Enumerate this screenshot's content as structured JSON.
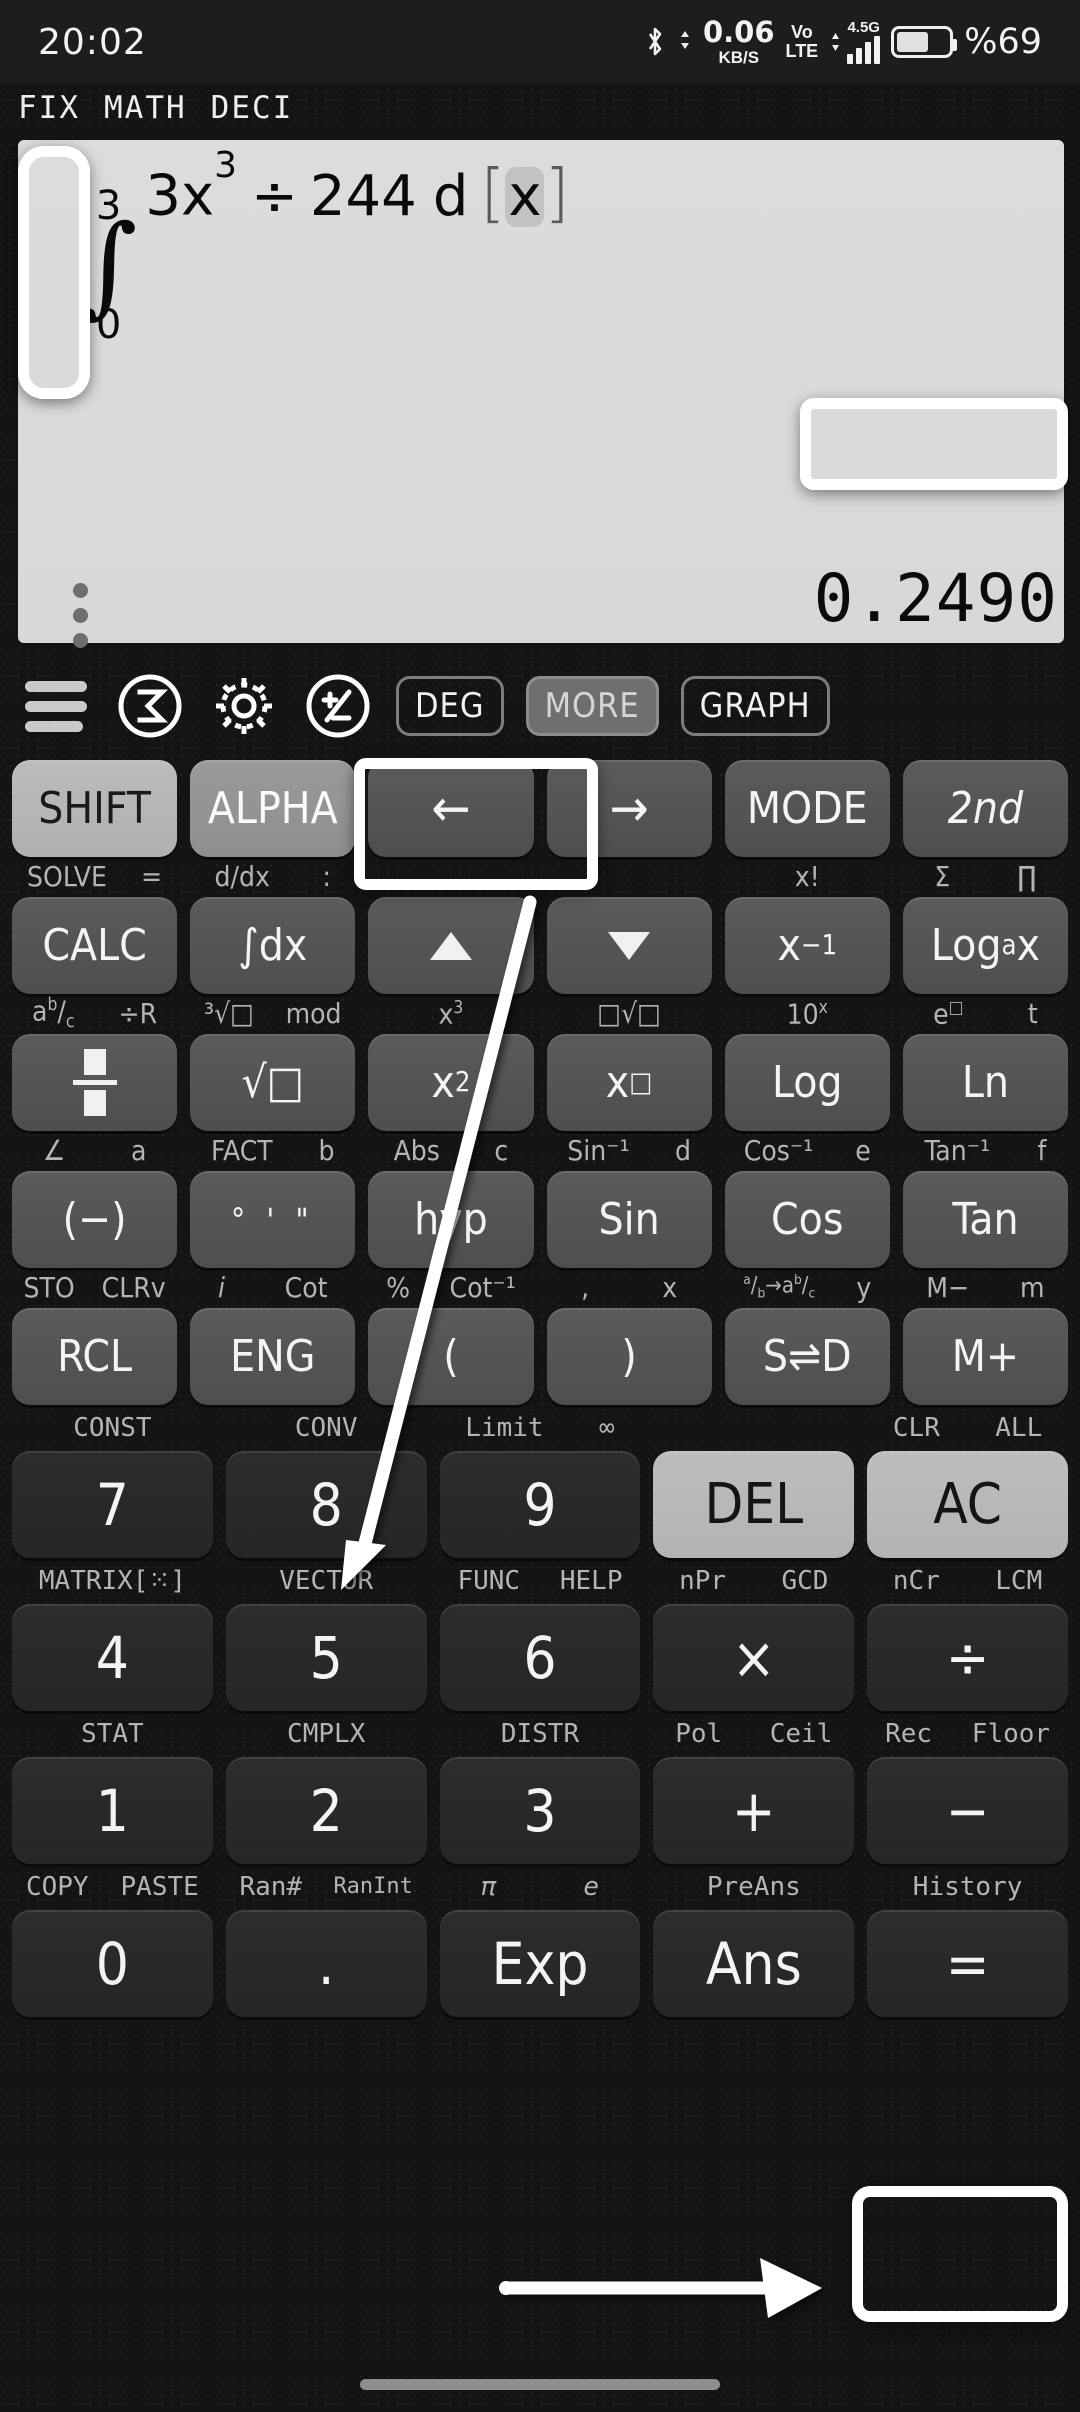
{
  "statusbar": {
    "time": "20:02",
    "net_speed_value": "0.06",
    "net_speed_unit": "KB/S",
    "volte_line1": "Vo",
    "volte_line2": "LTE",
    "network_type": "4.5G",
    "battery_percent": "%69",
    "bluetooth_icon": "bluetooth-icon",
    "signal_icon": "signal-bars-icon",
    "battery_icon": "battery-icon"
  },
  "mode_indicators": [
    "FIX",
    "MATH",
    "DECI"
  ],
  "display": {
    "expression": {
      "integral_upper": "3",
      "integral_symbol": "∫",
      "integral_lower": "0",
      "body": "3x",
      "exponent": "3",
      "operator": "÷",
      "operand": "244",
      "differential": "d",
      "bracket_open": "[",
      "variable": "x",
      "bracket_close": "]",
      "full_text": "∫(0..3) 3x^3 ÷ 244 d[x]"
    },
    "result": "0.2490",
    "overflow_menu": "vertical-dots-icon"
  },
  "toolbar": {
    "menu_icon": "hamburger-menu-icon",
    "sigma_icon": "sigma-circle-icon",
    "settings_icon": "gear-icon",
    "sign_icon": "plus-minus-circle-icon",
    "deg": "DEG",
    "more": "MORE",
    "graph": "GRAPH"
  },
  "keypad": {
    "row_shift": {
      "keys": [
        "SHIFT",
        "ALPHA",
        "←",
        "→",
        "MODE",
        "2nd"
      ]
    },
    "labels_calc": [
      "SOLVE",
      "=",
      "d/dx",
      ":",
      "",
      "",
      "",
      "x!",
      "Σ",
      "∏"
    ],
    "row_calc": {
      "keys": [
        "CALC",
        "∫dx",
        "▲",
        "▼",
        "x⁻¹",
        "Logₐx"
      ]
    },
    "labels_frac": [
      "a",
      "b/c",
      "÷R",
      "³√□",
      "mod",
      "x³",
      "",
      "□√□",
      "10ˣ",
      "e□",
      "t"
    ],
    "row_frac": {
      "keys": [
        "□/□",
        "√□",
        "x²",
        "x□",
        "Log",
        "Ln"
      ]
    },
    "labels_trig": [
      "∠",
      "a",
      "FACT",
      "b",
      "Abs",
      "c",
      "Sin⁻¹",
      "d",
      "Cos⁻¹",
      "e",
      "Tan⁻¹",
      "f"
    ],
    "row_trig": {
      "keys": [
        "(−)",
        "° ' \"",
        "hyp",
        "Sin",
        "Cos",
        "Tan"
      ]
    },
    "labels_mem": [
      "STO",
      "CLRv",
      "i",
      "Cot",
      "%",
      "Cot⁻¹",
      ",",
      "x",
      "a/b→a b/c",
      "y",
      "M−",
      "m"
    ],
    "row_mem": {
      "keys": [
        "RCL",
        "ENG",
        "(",
        ")",
        "S⇌D",
        "M+"
      ]
    },
    "labels_789_top": [
      "CONST",
      "CONV",
      "Limit",
      "∞",
      "",
      "CLR",
      "ALL"
    ],
    "row_789": {
      "keys": [
        "7",
        "8",
        "9",
        "DEL",
        "AC"
      ]
    },
    "labels_789_bot": [
      "MATRIX[⁙]",
      "VECTOR",
      "FUNC",
      "HELP",
      "nPr",
      "GCD",
      "nCr",
      "LCM"
    ],
    "row_456": {
      "keys": [
        "4",
        "5",
        "6",
        "×",
        "÷"
      ]
    },
    "labels_456_bot": [
      "STAT",
      "CMPLX",
      "DISTR",
      "Pol",
      "Ceil",
      "Rec",
      "Floor"
    ],
    "row_123": {
      "keys": [
        "1",
        "2",
        "3",
        "+",
        "−"
      ]
    },
    "labels_123_bot": [
      "COPY",
      "PASTE",
      "Ran#",
      "RanInt",
      "π",
      "e",
      "PreAns",
      "History"
    ],
    "row_0": {
      "keys": [
        "0",
        ".",
        "Exp",
        "Ans",
        "="
      ]
    }
  },
  "annotations": {
    "highlight_integral": "integral-symbol-highlight",
    "highlight_result": "result-highlight",
    "highlight_arrows": "cursor-arrow-keys-highlight",
    "highlight_equals": "equals-key-highlight",
    "arrow_1": "arrow-from-cursor-keys-to-open-paren",
    "arrow_2": "arrow-pointing-to-equals-key"
  },
  "colors": {
    "display_bg": "#dcdcdc",
    "body_bg": "#141414",
    "key_fn": "#5b5b5b",
    "key_num": "#2c2c2c",
    "key_light": "#bdbdbd",
    "highlight": "#ffffff",
    "label_text": "#b4b4b4"
  }
}
